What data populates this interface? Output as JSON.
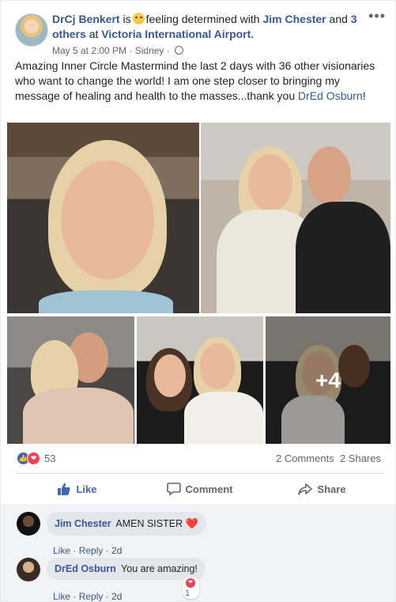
{
  "post": {
    "author": "DrCj Benkert",
    "is_text": "is",
    "feeling_text": "feeling determined with",
    "tagged_name": "Jim Chester",
    "and_text": "and",
    "others": "3 others",
    "at_text": "at",
    "location": "Victoria International Airport.",
    "date": "May 5 at 2:00 PM",
    "place": "Sidney",
    "separator": "·",
    "body": "Amazing Inner Circle Mastermind the last 2 days with 36 other visionaries who want to change the world! I am one step closer to bringing my message of healing and health to the masses...thank you ",
    "body_mention": "DrEd Osburn",
    "body_end": "!",
    "more_label": "•••"
  },
  "photos": {
    "more_overlay": "+4"
  },
  "stats": {
    "reaction_count": "53",
    "comments": "2 Comments",
    "shares": "2 Shares"
  },
  "actions": {
    "like": "Like",
    "comment": "Comment",
    "share": "Share"
  },
  "comments": [
    {
      "name": "Jim Chester",
      "text": "AMEN SISTER",
      "emoji": "❤️",
      "like": "Like",
      "reply": "Reply",
      "time": "2d",
      "dot": "·"
    },
    {
      "name": "DrEd Osburn",
      "text": "You are amazing!",
      "like": "Like",
      "reply": "Reply",
      "time": "2d",
      "dot": "·",
      "reaction_count": "1"
    }
  ],
  "colors": {
    "link": "#365899",
    "like_blue": "#4267b2",
    "love_red": "#f33e58",
    "comment_bg": "#f2f3f5"
  },
  "icons": {
    "more": "more-options-icon",
    "globe": "globe-icon",
    "like": "thumbs-up-icon",
    "comment": "speech-bubble-icon",
    "share": "share-arrow-icon",
    "love": "heart-icon"
  }
}
